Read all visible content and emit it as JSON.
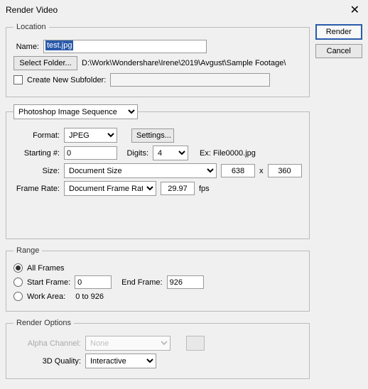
{
  "window": {
    "title": "Render Video"
  },
  "buttons": {
    "render": "Render",
    "cancel": "Cancel",
    "selectFolder": "Select Folder...",
    "settings": "Settings..."
  },
  "location": {
    "legend": "Location",
    "nameLabel": "Name:",
    "nameValue": "test.jpg",
    "path": "D:\\Work\\Wondershare\\Irene\\2019\\Avgust\\Sample Footage\\",
    "createSubLabel": "Create New Subfolder:",
    "subValue": ""
  },
  "export": {
    "preset": "Photoshop Image Sequence",
    "formatLabel": "Format:",
    "format": "JPEG",
    "startLabel": "Starting #:",
    "start": "0",
    "digitsLabel": "Digits:",
    "digits": "4",
    "example": "Ex: File0000.jpg",
    "sizeLabel": "Size:",
    "sizeMode": "Document Size",
    "width": "638",
    "x": "x",
    "height": "360",
    "frLabel": "Frame Rate:",
    "frMode": "Document Frame Rate",
    "fr": "29.97",
    "fps": "fps"
  },
  "range": {
    "legend": "Range",
    "all": "All Frames",
    "startLabel": "Start Frame:",
    "start": "0",
    "endLabel": "End Frame:",
    "end": "926",
    "workLabel": "Work Area:",
    "workRange": "0 to 926"
  },
  "options": {
    "legend": "Render Options",
    "alphaLabel": "Alpha Channel:",
    "alpha": "None",
    "qLabel": "3D Quality:",
    "q": "Interactive"
  }
}
